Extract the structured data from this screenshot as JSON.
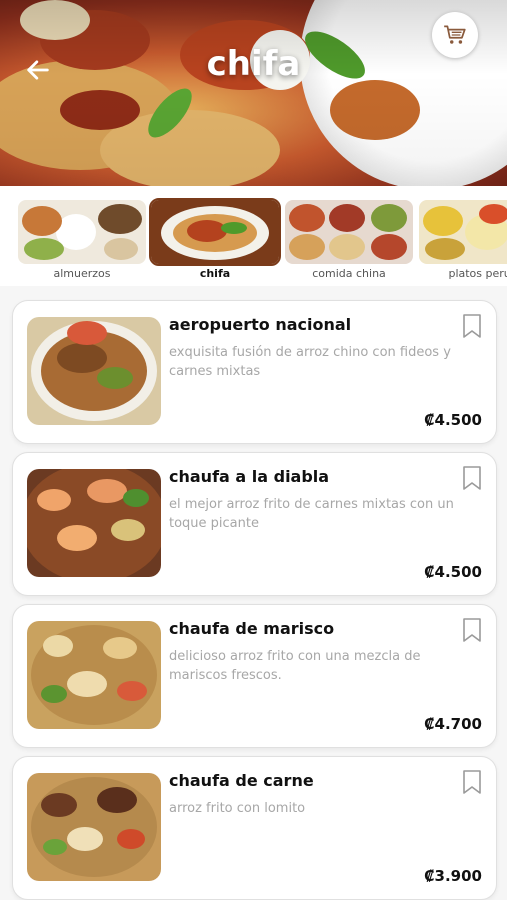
{
  "header": {
    "title": "chifa",
    "back_icon": "arrow-left-icon",
    "cart_icon": "shopping-cart-icon"
  },
  "categories": [
    {
      "label": "almuerzos"
    },
    {
      "label": "chifa",
      "active": true
    },
    {
      "label": "comida china"
    },
    {
      "label": "platos perua"
    }
  ],
  "items": [
    {
      "name": "aeropuerto nacional",
      "description": "exquisita fusión de arroz chino con fideos y carnes mixtas",
      "price": "₡4.500"
    },
    {
      "name": "chaufa a la diabla",
      "description": "el mejor arroz frito de carnes mixtas con un toque picante",
      "price": "₡4.500"
    },
    {
      "name": "chaufa de marisco",
      "description": "delicioso arroz frito con una mezcla de mariscos frescos.",
      "price": "₡4.700"
    },
    {
      "name": "chaufa de carne",
      "description": "arroz frito con lomito",
      "price": "₡3.900"
    }
  ],
  "colors": {
    "accent": "#7a3b1a",
    "text": "#111111",
    "muted": "#a7a7a7"
  }
}
